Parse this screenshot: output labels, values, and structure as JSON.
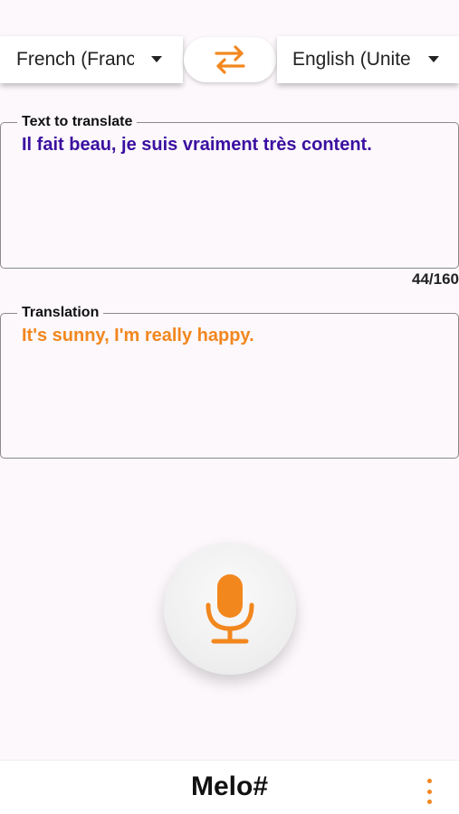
{
  "languages": {
    "source": "French (France)",
    "target": "English (United States)"
  },
  "input": {
    "label": "Text to translate",
    "value": "Il fait beau, je suis vraiment très content.",
    "char_count": "44/160"
  },
  "output": {
    "label": "Translation",
    "value": "It's sunny, I'm really happy."
  },
  "icons": {
    "swap": "swap-arrows-icon",
    "mic": "microphone-icon",
    "menu": "more-vertical-icon"
  },
  "colors": {
    "accent": "#f2871e",
    "source_text": "#3b10a0"
  },
  "footer": {
    "app_name": "Melo#"
  }
}
